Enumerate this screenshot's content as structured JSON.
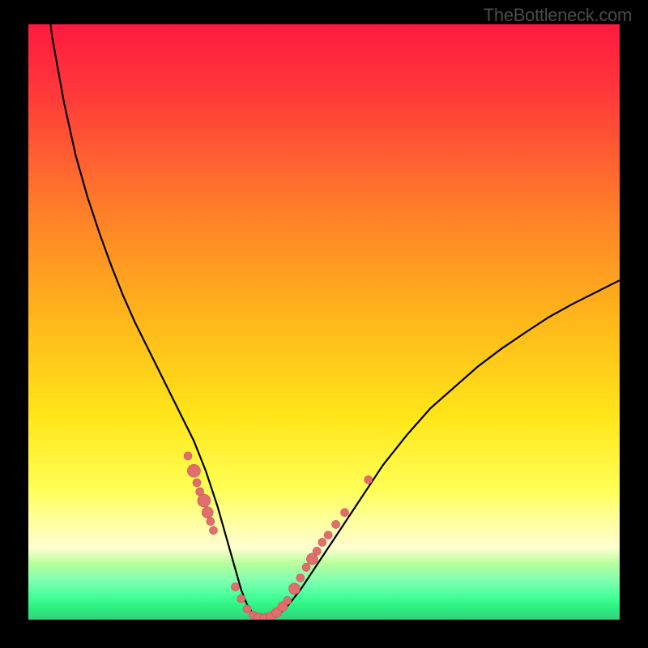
{
  "watermark": "TheBottleneck.com",
  "gradient": {
    "stops": [
      {
        "offset": 0.0,
        "color": "#ff1a40"
      },
      {
        "offset": 0.12,
        "color": "#ff3a3a"
      },
      {
        "offset": 0.3,
        "color": "#ff7a2a"
      },
      {
        "offset": 0.5,
        "color": "#ffb81a"
      },
      {
        "offset": 0.66,
        "color": "#ffe61a"
      },
      {
        "offset": 0.78,
        "color": "#ffff55"
      },
      {
        "offset": 0.83,
        "color": "#ffff99"
      },
      {
        "offset": 0.88,
        "color": "#fffed0"
      },
      {
        "offset": 0.905,
        "color": "#b8ff9c"
      },
      {
        "offset": 0.935,
        "color": "#7fffb0"
      },
      {
        "offset": 0.96,
        "color": "#46ff9a"
      },
      {
        "offset": 0.98,
        "color": "#2cf080"
      },
      {
        "offset": 1.0,
        "color": "#34d080"
      }
    ]
  },
  "colors": {
    "curve": "#000000",
    "markers": "#e26d6d",
    "marker_stroke": "#c35555",
    "bg": "#000000",
    "watermark": "#4a4a4a"
  },
  "chart_data": {
    "type": "line",
    "title": "",
    "xlabel": "",
    "ylabel": "",
    "xlim": [
      0,
      100
    ],
    "ylim": [
      0,
      100
    ],
    "series": [
      {
        "name": "bottleneck-curve",
        "x": [
          2,
          4,
          6,
          8,
          10,
          12,
          14,
          16,
          18,
          20,
          22,
          24,
          25,
          26,
          27,
          28,
          29,
          30,
          31,
          32,
          33,
          34,
          35,
          36,
          37,
          38,
          39,
          40,
          42,
          44,
          46,
          48,
          50,
          52,
          54,
          56,
          58,
          60,
          64,
          68,
          72,
          76,
          80,
          84,
          88,
          92,
          96,
          100
        ],
        "y": [
          115,
          98,
          87,
          78,
          71,
          65,
          59.5,
          54.5,
          50,
          46,
          42,
          38,
          36,
          34,
          32,
          30,
          27.5,
          25,
          22,
          19,
          15.5,
          12,
          8.5,
          5,
          2.5,
          1,
          0.2,
          0,
          0.5,
          2.5,
          5,
          8,
          11,
          14,
          17,
          20,
          23,
          26,
          31,
          35.5,
          39,
          42.5,
          45.5,
          48.2,
          50.8,
          53,
          55,
          57
        ]
      }
    ],
    "markers": {
      "name": "highlight-points",
      "points": [
        {
          "x": 27.0,
          "y": 27.5,
          "r": 5
        },
        {
          "x": 28.0,
          "y": 25.0,
          "r": 8
        },
        {
          "x": 28.5,
          "y": 23.0,
          "r": 5
        },
        {
          "x": 29.0,
          "y": 21.5,
          "r": 5
        },
        {
          "x": 29.7,
          "y": 20.0,
          "r": 8
        },
        {
          "x": 30.3,
          "y": 18.0,
          "r": 7
        },
        {
          "x": 30.8,
          "y": 16.5,
          "r": 5
        },
        {
          "x": 31.3,
          "y": 15.0,
          "r": 5
        },
        {
          "x": 35.0,
          "y": 5.5,
          "r": 5
        },
        {
          "x": 36.0,
          "y": 3.5,
          "r": 5
        },
        {
          "x": 37.0,
          "y": 1.8,
          "r": 5
        },
        {
          "x": 38.0,
          "y": 0.8,
          "r": 5
        },
        {
          "x": 39.0,
          "y": 0.3,
          "r": 6
        },
        {
          "x": 40.0,
          "y": 0.2,
          "r": 6
        },
        {
          "x": 41.0,
          "y": 0.5,
          "r": 6
        },
        {
          "x": 42.0,
          "y": 1.2,
          "r": 6
        },
        {
          "x": 43.0,
          "y": 2.2,
          "r": 6
        },
        {
          "x": 43.8,
          "y": 3.2,
          "r": 5
        },
        {
          "x": 45.0,
          "y": 5.2,
          "r": 7
        },
        {
          "x": 46.0,
          "y": 7.0,
          "r": 5
        },
        {
          "x": 47.0,
          "y": 8.8,
          "r": 5
        },
        {
          "x": 48.0,
          "y": 10.2,
          "r": 7
        },
        {
          "x": 48.8,
          "y": 11.5,
          "r": 5
        },
        {
          "x": 49.7,
          "y": 13.0,
          "r": 5
        },
        {
          "x": 50.7,
          "y": 14.2,
          "r": 5
        },
        {
          "x": 52.0,
          "y": 16.0,
          "r": 5
        },
        {
          "x": 53.5,
          "y": 18.0,
          "r": 5
        },
        {
          "x": 57.5,
          "y": 23.5,
          "r": 5
        }
      ]
    }
  }
}
